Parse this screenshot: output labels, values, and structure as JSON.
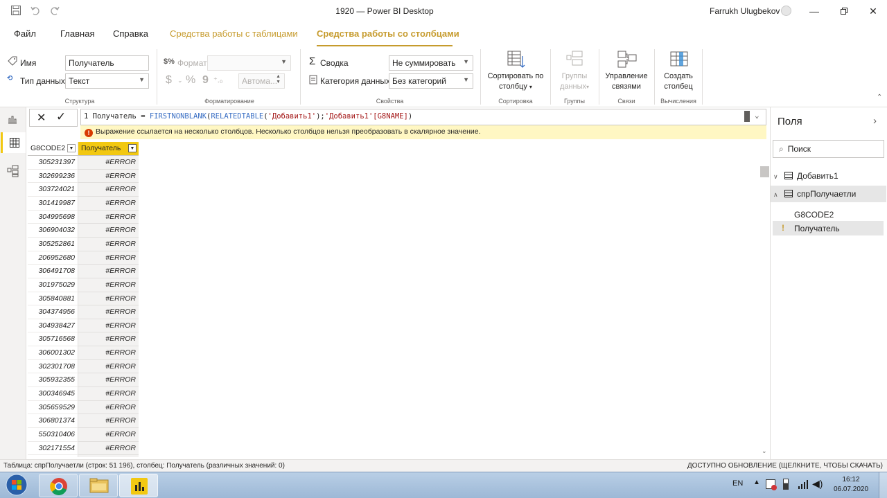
{
  "titlebar": {
    "title": "1920 — Power BI Desktop",
    "user": "Farrukh Ulugbekov",
    "save_icon": "save-icon",
    "undo_icon": "undo-icon",
    "redo_icon": "redo-icon"
  },
  "menu": {
    "file": "Файл",
    "home": "Главная",
    "help": "Справка",
    "table_tools": "Средства работы с таблицами",
    "column_tools": "Средства работы со столбцами"
  },
  "ribbon": {
    "name_label": "Имя",
    "name_value": "Получатель",
    "datatype_label": "Тип данных",
    "datatype_value": "Текст",
    "group_structure": "Структура",
    "format_label": "Формат",
    "format_value": "",
    "currency": "$",
    "percent": "%",
    "comma": "9",
    "auto_value": "Автома...",
    "group_formatting": "Форматирование",
    "summary_label": "Сводка",
    "summary_value": "Не суммировать",
    "category_label": "Категория данных",
    "category_value": "Без категорий",
    "group_properties": "Свойства",
    "sort_label1": "Сортировать по",
    "sort_label2": "столбцу",
    "group_sort": "Сортировка",
    "groups_label1": "Группы",
    "groups_label2": "данных",
    "group_groups": "Группы",
    "manage_label1": "Управление",
    "manage_label2": "связями",
    "group_relations": "Связи",
    "newcol_label1": "Создать",
    "newcol_label2": "столбец",
    "group_calc": "Вычисления"
  },
  "formula": {
    "line_no": "1",
    "column": "Получатель",
    "equals": " = ",
    "fn1": "FIRSTNONBLANK",
    "fn2": "RELATEDTABLE",
    "arg1": "'Добавить1'",
    "sep": ");",
    "arg2": "'Добавить1'[G8NAME]",
    "close": ")",
    "error": "Выражение ссылается на несколько столбцов. Несколько столбцов нельзя преобразовать в скалярное значение."
  },
  "table": {
    "col1": "G8CODE2",
    "col2": "Получатель",
    "rows": [
      {
        "code": "305231397",
        "val": "#ERROR"
      },
      {
        "code": "302699236",
        "val": "#ERROR"
      },
      {
        "code": "303724021",
        "val": "#ERROR"
      },
      {
        "code": "301419987",
        "val": "#ERROR"
      },
      {
        "code": "304995698",
        "val": "#ERROR"
      },
      {
        "code": "306904032",
        "val": "#ERROR"
      },
      {
        "code": "305252861",
        "val": "#ERROR"
      },
      {
        "code": "206952680",
        "val": "#ERROR"
      },
      {
        "code": "306491708",
        "val": "#ERROR"
      },
      {
        "code": "301975029",
        "val": "#ERROR"
      },
      {
        "code": "305840881",
        "val": "#ERROR"
      },
      {
        "code": "304374956",
        "val": "#ERROR"
      },
      {
        "code": "304938427",
        "val": "#ERROR"
      },
      {
        "code": "305716568",
        "val": "#ERROR"
      },
      {
        "code": "306001302",
        "val": "#ERROR"
      },
      {
        "code": "302301708",
        "val": "#ERROR"
      },
      {
        "code": "305932355",
        "val": "#ERROR"
      },
      {
        "code": "300346945",
        "val": "#ERROR"
      },
      {
        "code": "305659529",
        "val": "#ERROR"
      },
      {
        "code": "306801374",
        "val": "#ERROR"
      },
      {
        "code": "550310406",
        "val": "#ERROR"
      },
      {
        "code": "302171554",
        "val": "#ERROR"
      },
      {
        "code": "",
        "val": ""
      }
    ]
  },
  "fields": {
    "title": "Поля",
    "search_placeholder": "Поиск",
    "table1": "Добавить1",
    "table2": "спрПолучаетли",
    "field1": "G8CODE2",
    "field2": "Получатель"
  },
  "status": {
    "left": "Таблица: спрПолучаетли (строк: 51 196), столбец: Получатель (различных значений: 0)",
    "right": "ДОСТУПНО ОБНОВЛЕНИЕ (ЩЕЛКНИТЕ, ЧТОБЫ СКАЧАТЬ)"
  },
  "taskbar": {
    "lang": "EN",
    "time": "16:12",
    "date": "06.07.2020"
  }
}
